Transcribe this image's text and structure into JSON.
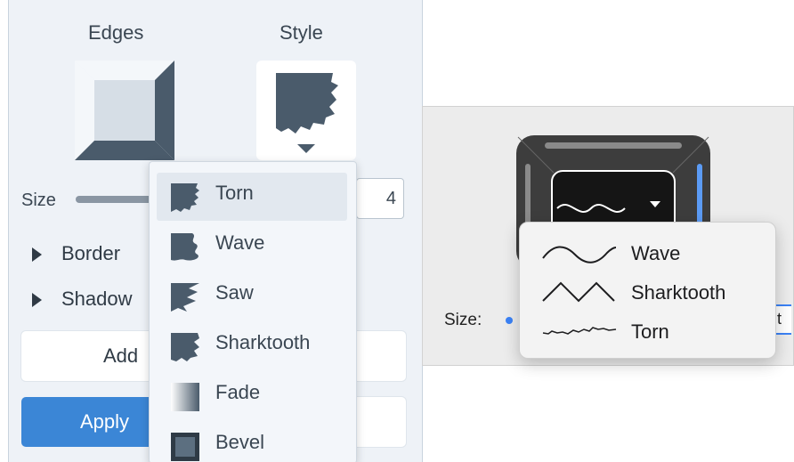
{
  "left": {
    "edges_label": "Edges",
    "style_label": "Style",
    "size_label": "Size",
    "size_value": "4",
    "border_label": "Border",
    "shadow_label": "Shadow",
    "add_label": "Add",
    "apply_label": "Apply",
    "style_menu": [
      {
        "label": "Torn",
        "icon": "torn-icon",
        "selected": true
      },
      {
        "label": "Wave",
        "icon": "wave-icon"
      },
      {
        "label": "Saw",
        "icon": "saw-icon"
      },
      {
        "label": "Sharktooth",
        "icon": "sharktooth-icon"
      },
      {
        "label": "Fade",
        "icon": "fade-icon"
      },
      {
        "label": "Bevel",
        "icon": "bevel-icon"
      }
    ]
  },
  "right": {
    "size_label": "Size:",
    "field_partial": "t",
    "menu": [
      {
        "label": "Wave",
        "icon": "wave-line-icon"
      },
      {
        "label": "Sharktooth",
        "icon": "sharktooth-line-icon"
      },
      {
        "label": "Torn",
        "icon": "torn-line-icon"
      }
    ]
  },
  "colors": {
    "accent": "#3b86d6",
    "panel_bg": "#eef2f7",
    "icon_dark": "#4a5b6b",
    "mac_accent": "#3b82f6"
  }
}
